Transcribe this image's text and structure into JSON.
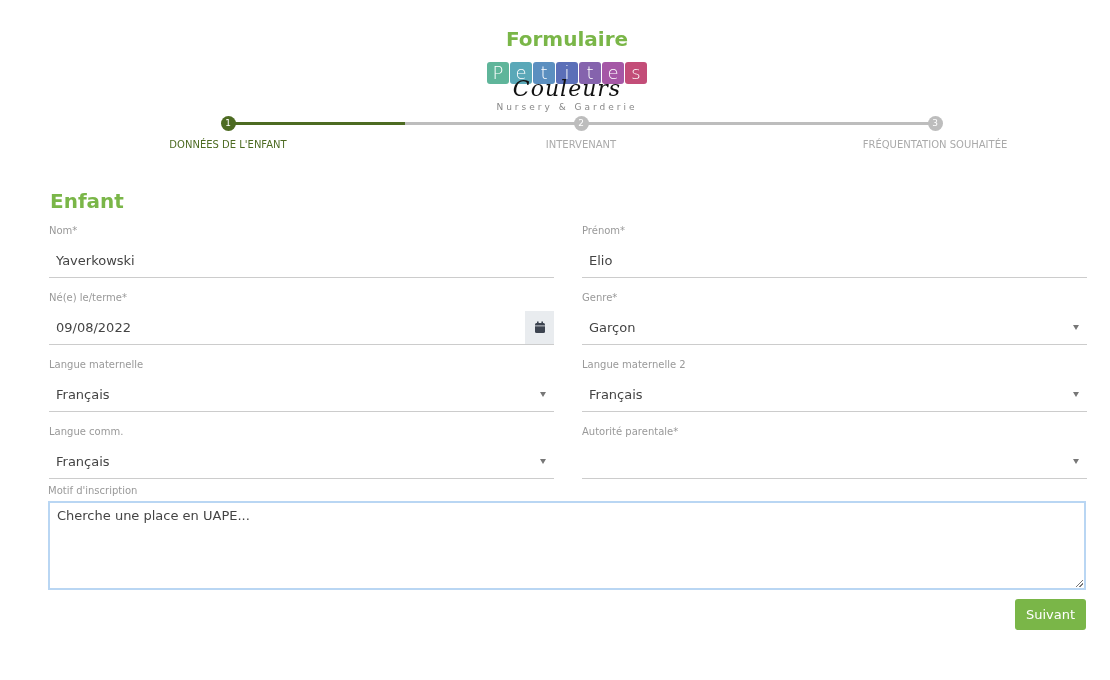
{
  "title": "Formulaire",
  "logo": {
    "tiles": [
      {
        "char": "P",
        "color": "#5fb59a"
      },
      {
        "char": "e",
        "color": "#5aa8b8"
      },
      {
        "char": "t",
        "color": "#5b8fc0"
      },
      {
        "char": "i",
        "color": "#5b6fb8"
      },
      {
        "char": "t",
        "color": "#8563ad"
      },
      {
        "char": "e",
        "color": "#a557a6"
      },
      {
        "char": "s",
        "color": "#c34d78"
      }
    ],
    "script": "Couleurs",
    "tagline": "Nursery & Garderie"
  },
  "steps": [
    {
      "number": "1",
      "label": "DONNÉES DE L'ENFANT",
      "selected": true
    },
    {
      "number": "2",
      "label": "INTERVENANT",
      "selected": false
    },
    {
      "number": "3",
      "label": "FRÉQUENTATION SOUHAITÉE",
      "selected": false
    }
  ],
  "progress": {
    "level": 0.25
  },
  "section_title": "Enfant",
  "fields": [
    {
      "kind": "text",
      "label": "Nom*",
      "value": "Yaverkowski"
    },
    {
      "kind": "text",
      "label": "Prénom*",
      "value": "Elio"
    },
    {
      "kind": "date",
      "label": "Né(e) le/terme*",
      "value": "09/08/2022"
    },
    {
      "kind": "select",
      "label": "Genre*",
      "value": "Garçon"
    },
    {
      "kind": "select",
      "label": "Langue maternelle",
      "value": "Français"
    },
    {
      "kind": "select",
      "label": "Langue maternelle 2",
      "value": "Français"
    },
    {
      "kind": "select",
      "label": "Langue comm.",
      "value": "Français"
    },
    {
      "kind": "select",
      "label": "Autorité parentale*"
    }
  ],
  "textarea": {
    "label": "Motif d'inscription",
    "value": "Cherche une place en UAPE...",
    "focused": true
  },
  "next_button": "Suivant"
}
